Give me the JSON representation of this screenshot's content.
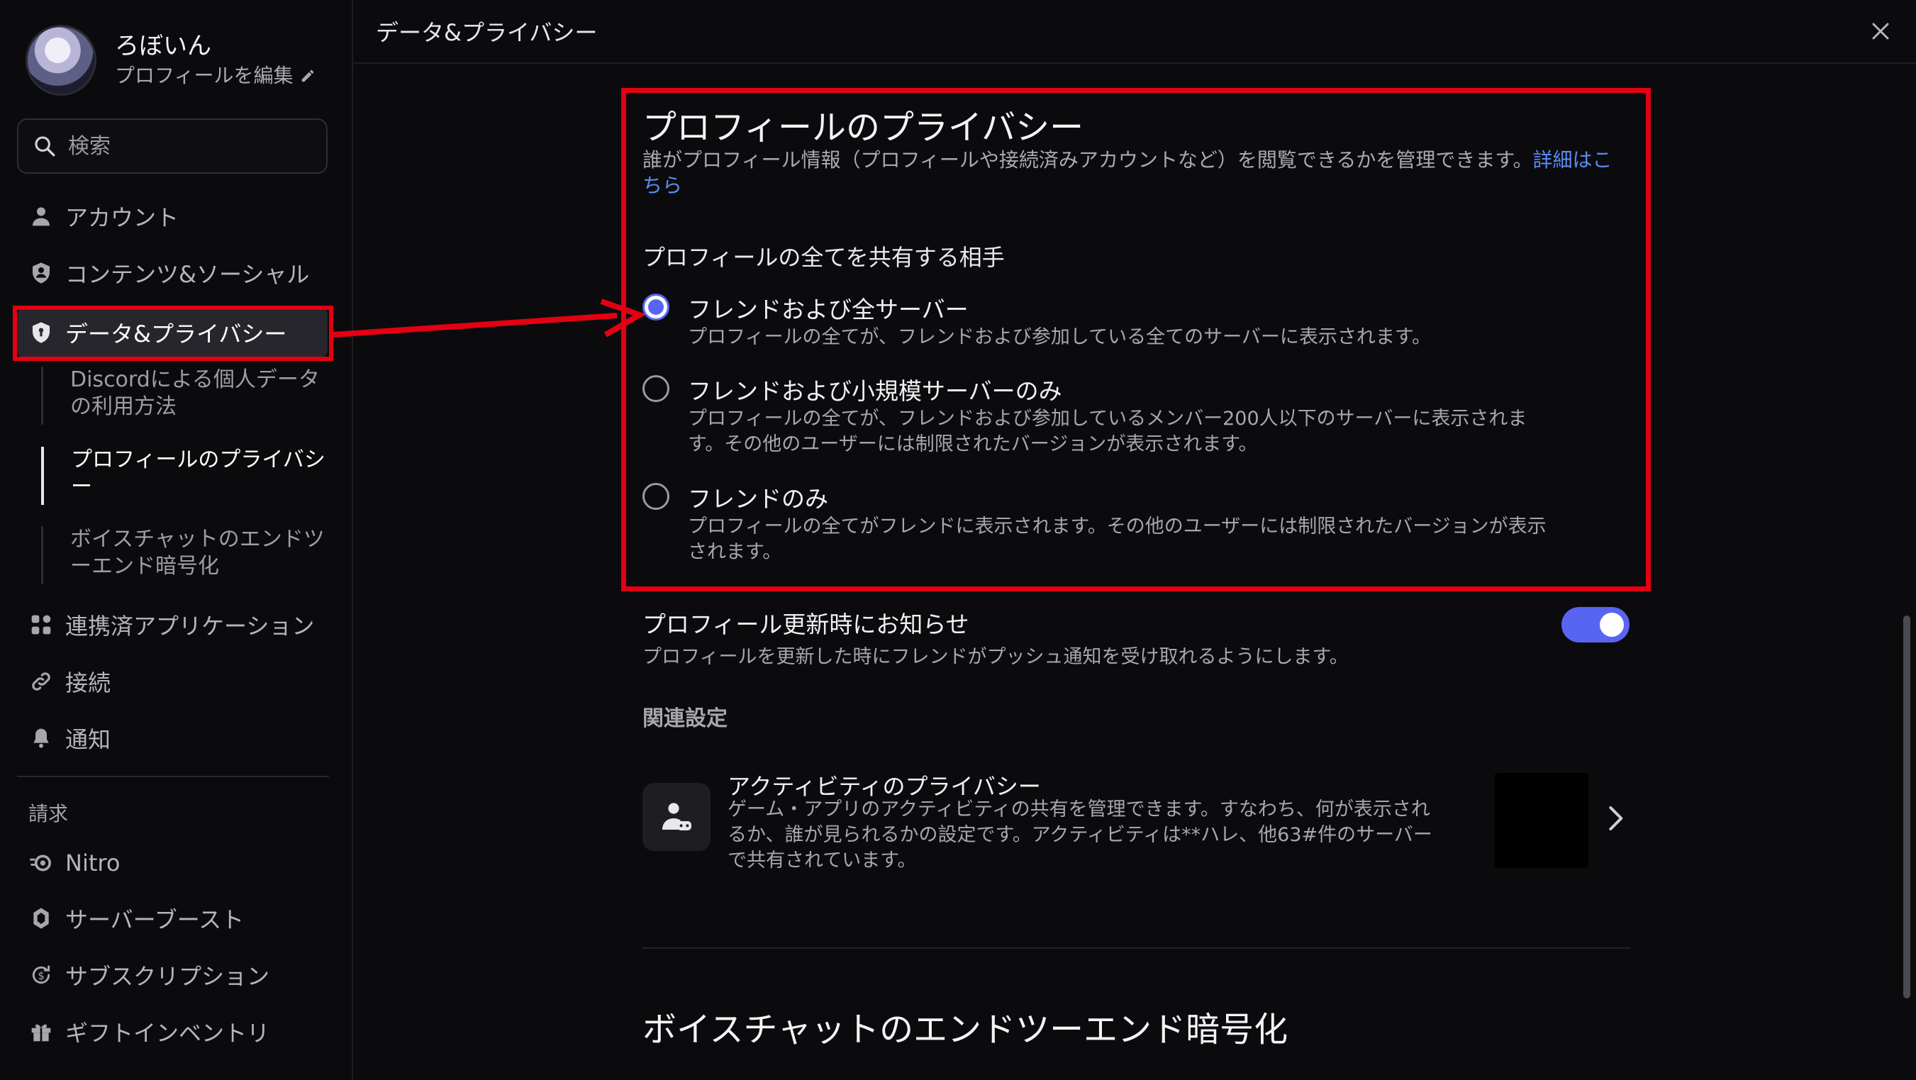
{
  "colors": {
    "accent": "#5865f2",
    "highlight": "#e30012",
    "link": "#5b8cf3",
    "background": "#0b0b0d"
  },
  "sidebar": {
    "username": "ろぼいん",
    "edit_profile": "プロフィールを編集",
    "search_placeholder": "検索",
    "items": [
      {
        "label": "アカウント",
        "icon": "person-icon"
      },
      {
        "label": "コンテンツ&ソーシャル",
        "icon": "shield-person-icon"
      },
      {
        "label": "データ&プライバシー",
        "icon": "shield-lock-icon",
        "active": true
      },
      {
        "label": "連携済アプリケーション",
        "icon": "apps-icon"
      },
      {
        "label": "接続",
        "icon": "link-icon"
      },
      {
        "label": "通知",
        "icon": "bell-icon"
      }
    ],
    "subitems": [
      {
        "label": "Discordによる個人データの利用方法"
      },
      {
        "label": "プロフィールのプライバシー",
        "current": true
      },
      {
        "label": "ボイスチャットのエンドツーエンド暗号化"
      }
    ],
    "billing_label": "請求",
    "billing_items": [
      {
        "label": "Nitro",
        "icon": "nitro-icon"
      },
      {
        "label": "サーバーブースト",
        "icon": "boost-icon"
      },
      {
        "label": "サブスクリプション",
        "icon": "subscription-icon"
      },
      {
        "label": "ギフトインベントリ",
        "icon": "gift-icon"
      }
    ]
  },
  "topbar": {
    "title": "データ&プライバシー"
  },
  "main": {
    "section_title": "プロフィールのプライバシー",
    "section_desc": "誰がプロフィール情報（プロフィールや接続済みアカウントなど）を閲覧できるかを管理できます。",
    "learn_more": "詳細はこちら",
    "share_title": "プロフィールの全てを共有する相手",
    "options": [
      {
        "title": "フレンドおよび全サーバー",
        "desc": "プロフィールの全てが、フレンドおよび参加している全てのサーバーに表示されます。",
        "selected": true
      },
      {
        "title": "フレンドおよび小規模サーバーのみ",
        "desc": "プロフィールの全てが、フレンドおよび参加しているメンバー200人以下のサーバーに表示されます。その他のユーザーには制限されたバージョンが表示されます。",
        "selected": false
      },
      {
        "title": "フレンドのみ",
        "desc": "プロフィールの全てがフレンドに表示されます。その他のユーザーには制限されたバージョンが表示されます。",
        "selected": false
      }
    ],
    "notify": {
      "title": "プロフィール更新時にお知らせ",
      "desc": "プロフィールを更新した時にフレンドがプッシュ通知を受け取れるようにします。",
      "enabled": true
    },
    "related_label": "関連設定",
    "related_card": {
      "title": "アクティビティのプライバシー",
      "desc": "ゲーム・アプリのアクティビティの共有を管理できます。すなわち、何が表示されるか、誰が見られるかの設定です。アクティビティは**ハレ、他63#件のサーバーで共有されています。"
    },
    "next_section_title": "ボイスチャットのエンドツーエンド暗号化"
  }
}
